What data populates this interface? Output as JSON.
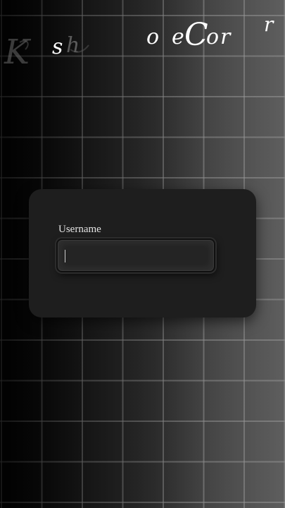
{
  "logo": {
    "letters": [
      "K",
      "s",
      "h",
      "o",
      "e",
      "C",
      "o",
      "r",
      "r"
    ],
    "letter_colors": [
      "#6a6a6a",
      "#ffffff",
      "#7a7a7a",
      "#ffffff",
      "#ffffff",
      "#ffffff",
      "#ffffff",
      "#ffffff",
      "#ffffff"
    ]
  },
  "form": {
    "username_label": "Username",
    "username_value": "",
    "username_placeholder": ""
  },
  "colors": {
    "card_background": "#1e1e1e",
    "input_background": "#242424",
    "label_text": "#e4e4e4"
  }
}
